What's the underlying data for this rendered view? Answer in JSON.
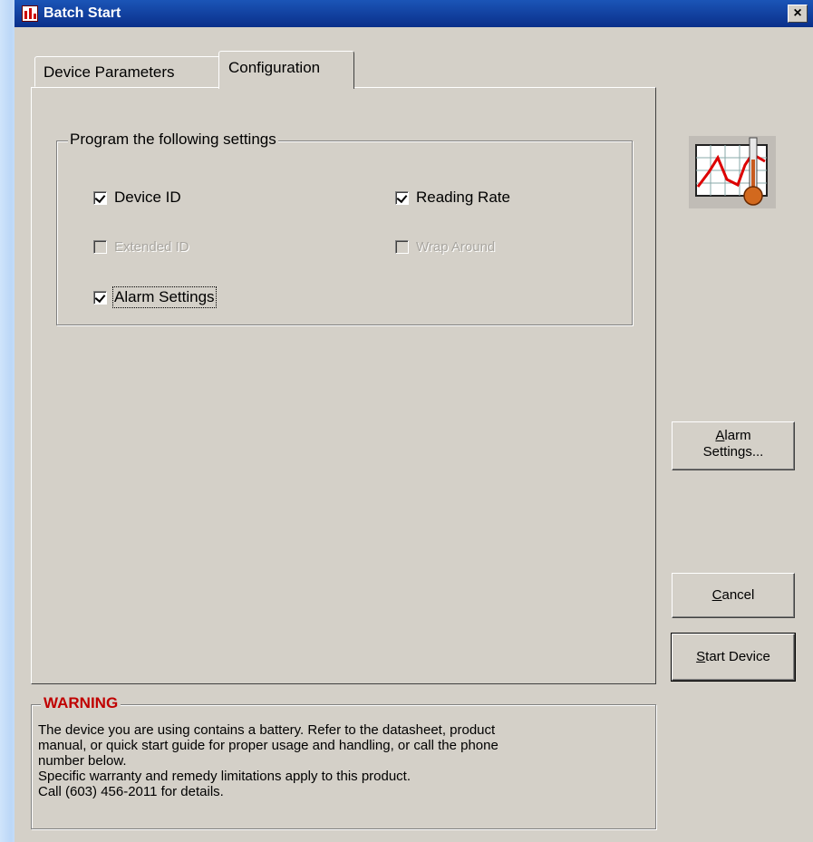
{
  "window": {
    "title": "Batch Start",
    "close_label": "×"
  },
  "tabs": [
    {
      "label": "Device Parameters",
      "active": false
    },
    {
      "label": "Configuration",
      "active": true
    }
  ],
  "program_group": {
    "legend": "Program the following settings",
    "checkboxes": [
      {
        "label": "Device ID",
        "checked": true,
        "enabled": true
      },
      {
        "label": "Reading Rate",
        "checked": true,
        "enabled": true
      },
      {
        "label": "Extended ID",
        "checked": false,
        "enabled": false
      },
      {
        "label": "Wrap Around",
        "checked": false,
        "enabled": false
      },
      {
        "label": "Alarm Settings",
        "checked": true,
        "enabled": true,
        "focused": true
      }
    ]
  },
  "buttons": {
    "alarm_settings": {
      "mnemonic": "A",
      "line1_rest": "larm",
      "line2": "Settings..."
    },
    "cancel": {
      "mnemonic": "C",
      "rest": "ancel"
    },
    "start_device": {
      "mnemonic": "S",
      "rest": "tart Device"
    }
  },
  "warning": {
    "legend": "WARNING",
    "lines": [
      "The device you are using contains a battery. Refer to the datasheet, product",
      "manual, or quick start guide for proper usage and handling, or call the phone",
      "number below.",
      "Specific warranty and remedy limitations apply to this product.",
      "Call (603) 456-2011 for details."
    ]
  },
  "icons": {
    "title_icon": "chart-logger-icon",
    "app_icon": "temperature-graph-icon"
  },
  "colors": {
    "titlebar": "#0a2f8a",
    "window_face": "#d4d0c8",
    "warning_red": "#c00000"
  }
}
